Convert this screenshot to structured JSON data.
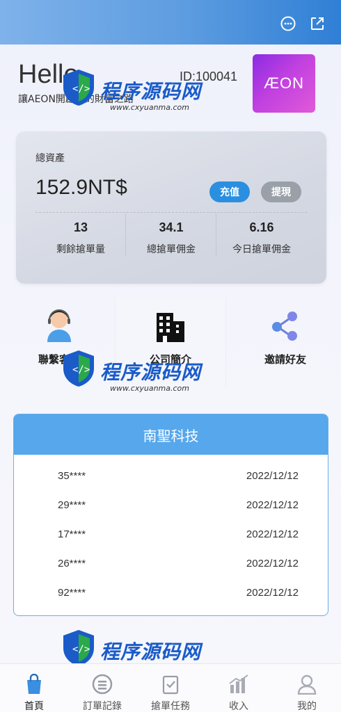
{
  "header": {
    "message_icon": "chat-bubble-icon",
    "share_icon": "external-link-icon"
  },
  "hero": {
    "greeting": "Hello",
    "slogan": "讓AEON開啟你的財富之路",
    "user_id": "ID:100041",
    "brand_logo_text": "ÆON"
  },
  "assets": {
    "label": "總資產",
    "value": "152.9NT$",
    "deposit_label": "充值",
    "withdraw_label": "提現",
    "stats": [
      {
        "value": "13",
        "label": "剩餘搶單量"
      },
      {
        "value": "34.1",
        "label": "總搶單佣金"
      },
      {
        "value": "6.16",
        "label": "今日搶單佣金"
      }
    ]
  },
  "quick_links": [
    {
      "label": "聯繫客服",
      "icon": "customer-service-icon"
    },
    {
      "label": "公司簡介",
      "icon": "building-icon"
    },
    {
      "label": "邀請好友",
      "icon": "share-nodes-icon"
    }
  ],
  "company": {
    "title": "南聖科技",
    "records": [
      {
        "user": "35****",
        "date": "2022/12/12"
      },
      {
        "user": "29****",
        "date": "2022/12/12"
      },
      {
        "user": "17****",
        "date": "2022/12/12"
      },
      {
        "user": "26****",
        "date": "2022/12/12"
      },
      {
        "user": "92****",
        "date": "2022/12/12"
      }
    ]
  },
  "watermark": {
    "text": "程序源码网",
    "url": "www.cxyuanma.com"
  },
  "tabbar": {
    "tabs": [
      {
        "label": "首頁",
        "icon": "shopping-bag-icon",
        "active": true
      },
      {
        "label": "訂單記錄",
        "icon": "list-circle-icon",
        "active": false
      },
      {
        "label": "搶單任務",
        "icon": "task-icon",
        "active": false
      },
      {
        "label": "收入",
        "icon": "bar-chart-icon",
        "active": false
      },
      {
        "label": "我的",
        "icon": "user-icon",
        "active": false
      }
    ]
  },
  "colors": {
    "primary": "#2a8fe0",
    "header_blue": "#56a7ec",
    "gray_button": "#9aa0a8",
    "brand_purple": "#c040e0"
  }
}
